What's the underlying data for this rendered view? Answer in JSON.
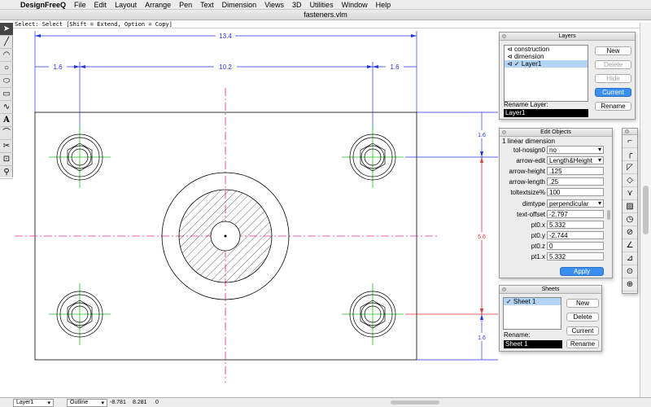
{
  "menubar": {
    "app_name": "DesignFreeQ",
    "items": [
      "File",
      "Edit",
      "Layout",
      "Arrange",
      "Pen",
      "Text",
      "Dimension",
      "Views",
      "3D",
      "Utilities",
      "Window",
      "Help"
    ]
  },
  "window": {
    "title": "fasteners.vlm"
  },
  "status_hint": "Select: Select [Shift = Extend, Option = Copy]",
  "toolbox": {
    "tools": [
      "arrow-pointer-icon",
      "line-icon",
      "arc-icon",
      "circle-icon",
      "ellipse-icon",
      "rectangle-icon",
      "curve-icon",
      "text-icon",
      "fillet-icon",
      "trim-icon",
      "stretch-icon",
      "zoom-icon"
    ]
  },
  "drawing": {
    "dimensions": {
      "overall_width": "13.4",
      "left_inset": "1.6",
      "center_span": "10.2",
      "right_inset": "1.6",
      "top_inset": "1.6",
      "center_height": "5.6",
      "bottom_inset": "1.6"
    },
    "colors": {
      "dimension": "#2233ee",
      "centerline": "#e0289a",
      "crosshair": "#22bb22",
      "outline": "#000000",
      "highlight": "#e03030"
    }
  },
  "layers_palette": {
    "title": "Layers",
    "layers": [
      {
        "name": "construction",
        "prefix": "⊲"
      },
      {
        "name": "dimension",
        "prefix": "⊲"
      },
      {
        "name": "Layer1",
        "prefix": "⊲ ✓"
      }
    ],
    "buttons": {
      "new": "New",
      "delete": "Delete",
      "hide": "Hide",
      "current": "Current",
      "rename": "Rename"
    },
    "rename_label": "Rename Layer:",
    "rename_value": "Layer1"
  },
  "edit_objects": {
    "title": "Edit Objects",
    "summary": "1 linear dimension",
    "rows": [
      {
        "label": "tol-nosign0",
        "value": "no",
        "dropdown": true
      },
      {
        "label": "arrow-edit",
        "value": "Length&Height",
        "dropdown": true
      },
      {
        "label": "arrow-height",
        "value": ".125",
        "dropdown": false
      },
      {
        "label": "arrow-length",
        "value": ".25",
        "dropdown": false
      },
      {
        "label": "toltextsize%",
        "value": "100",
        "dropdown": false
      },
      {
        "label": "dimtype",
        "value": "perpendicular",
        "dropdown": true
      },
      {
        "label": "text-offset",
        "value": "-2.797",
        "dropdown": false
      },
      {
        "label": "pt0.x",
        "value": "5.332",
        "dropdown": false
      },
      {
        "label": "pt0.y",
        "value": "-2.744",
        "dropdown": false
      },
      {
        "label": "pt0.z",
        "value": "0",
        "dropdown": false
      },
      {
        "label": "pt1.x",
        "value": "5.332",
        "dropdown": false
      }
    ],
    "apply_label": "Apply"
  },
  "sheets_palette": {
    "title": "Sheets",
    "sheets": [
      "✓ Sheet 1"
    ],
    "buttons": {
      "new": "New",
      "delete": "Delete",
      "current": "Current",
      "rename": "Rename"
    },
    "rename_label": "Rename:",
    "rename_value": "Sheet 1"
  },
  "side_tools": [
    "corner-icon",
    "corner-round-icon",
    "chamfer-icon",
    "offset-icon",
    "extend-icon",
    "hatch-icon",
    "circle-tangent-icon",
    "circle-slash-icon",
    "angle-icon",
    "measure-icon",
    "point-icon",
    "target-icon"
  ],
  "bottombar": {
    "layer_select": "Layer1",
    "view_select": "Outline",
    "coord_x": "-8.781",
    "coord_y": "8.281",
    "coord_z": "0"
  }
}
